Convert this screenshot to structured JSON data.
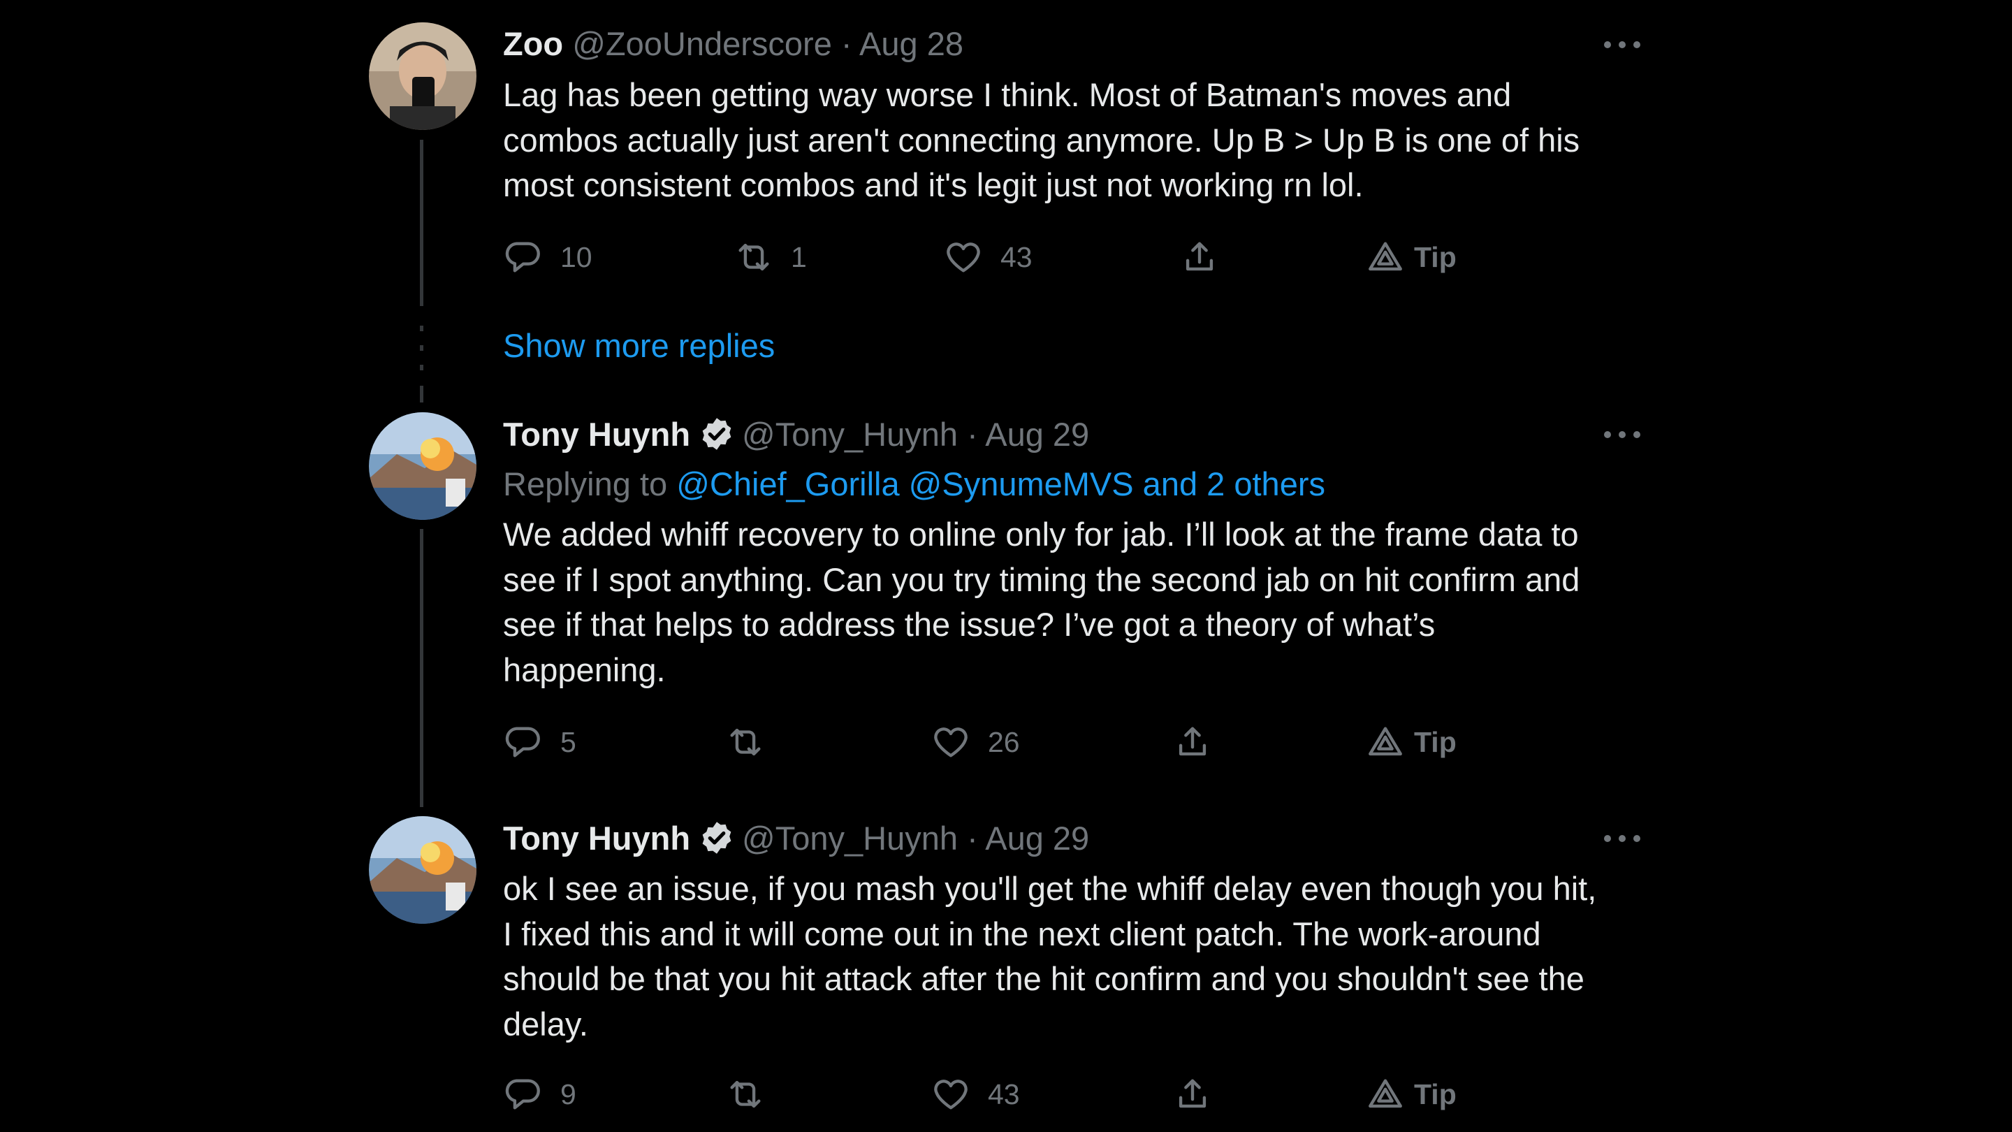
{
  "tweets": [
    {
      "name": "Zoo",
      "handle": "@ZooUnderscore",
      "separator": "·",
      "date": "Aug 28",
      "verified": false,
      "text": "Lag has been getting way worse I think. Most of Batman's moves and\ncombos actually just aren't connecting anymore. Up B > Up B is one of his\nmost consistent combos and it's legit just not working rn lol.",
      "replies": "10",
      "retweets": "1",
      "likes": "43",
      "tip_label": "Tip"
    },
    {
      "name": "Tony Huynh",
      "handle": "@Tony_Huynh",
      "separator": "·",
      "date": "Aug 29",
      "verified": true,
      "replying_prefix": "Replying to",
      "replying_mentions": "@Chief_Gorilla @SynumeMVS and 2 others",
      "text": "We added whiff recovery to online only for jab. I’ll look at the frame data to\nsee if I spot anything. Can you try timing the second jab on hit confirm and\nsee if that helps to address the issue? I’ve got a theory of what’s\nhappening.",
      "replies": "5",
      "retweets": "",
      "likes": "26",
      "tip_label": "Tip"
    },
    {
      "name": "Tony Huynh",
      "handle": "@Tony_Huynh",
      "separator": "·",
      "date": "Aug 29",
      "verified": true,
      "text": "ok I see an issue, if you mash you'll get the whiff delay even though you hit,\nI fixed this and it will come out in the next client patch. The work-around\nshould be that you hit attack after the hit confirm and you shouldn't see the\ndelay.",
      "replies": "9",
      "retweets": "",
      "likes": "43",
      "tip_label": "Tip"
    }
  ],
  "show_more_replies": "Show more replies",
  "colors": {
    "background": "#000000",
    "text": "#e7e9ea",
    "muted": "#71767b",
    "link": "#1d9bf0"
  }
}
